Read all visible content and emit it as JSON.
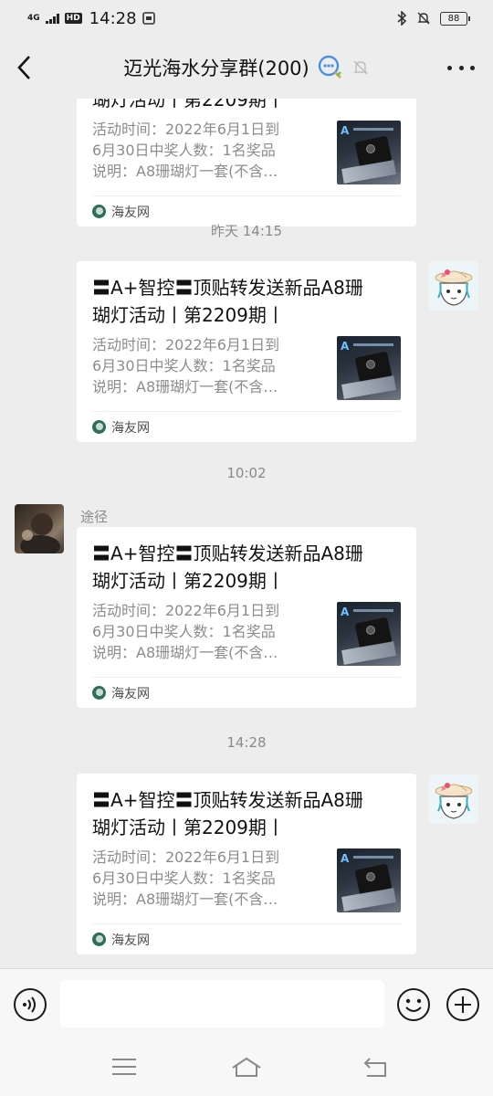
{
  "status_bar": {
    "network": "4G",
    "hd": "HD",
    "time": "14:28",
    "battery": "88"
  },
  "nav": {
    "title": "迈光海水分享群(200)"
  },
  "card_common": {
    "title_lines": [
      "〓A+智控〓顶贴转发送新品A8珊",
      "瑚灯活动丨第2209期丨"
    ],
    "desc_lines": [
      "活动时间：2022年6月1日到",
      "6月30日中奖人数：1名奖品",
      "说明：A8珊瑚灯一套(不含…"
    ],
    "source": "海友网"
  },
  "timestamps": {
    "t1": "昨天 14:15",
    "t2": "10:02",
    "t3": "14:28"
  },
  "sender_name": "途径",
  "input": {
    "placeholder": ""
  }
}
